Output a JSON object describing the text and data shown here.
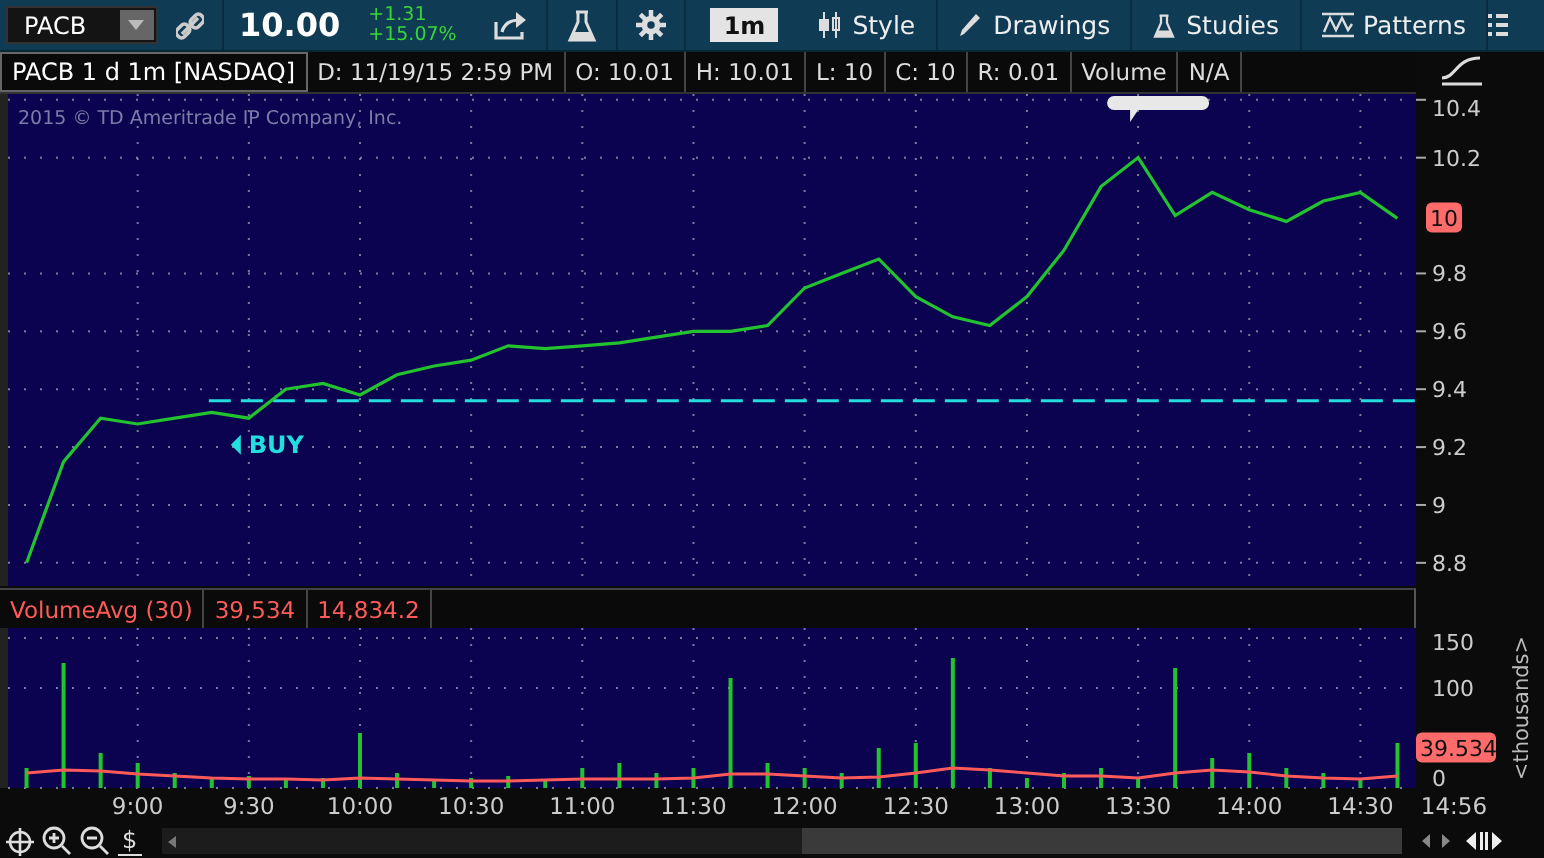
{
  "toolbar": {
    "symbol": "PACB",
    "last_price": "10.00",
    "change": "+1.31",
    "change_percent": "+15.07%",
    "interval": "1m",
    "menus": [
      "Style",
      "Drawings",
      "Studies",
      "Patterns"
    ]
  },
  "info_bar": {
    "title": "PACB 1 d 1m [NASDAQ]",
    "fields": [
      "D: 11/19/15 2:59 PM",
      "O: 10.01",
      "H: 10.01",
      "L: 10",
      "C: 10",
      "R: 0.01",
      "Volume",
      "N/A"
    ]
  },
  "price_chart": {
    "copyright": "2015 © TD Ameritrade IP Company, Inc.",
    "current_price_badge": "10",
    "chart_data": {
      "type": "line",
      "grid": true,
      "series": [
        {
          "color": "#22c32e",
          "values": [
            8.8,
            9.15,
            9.3,
            9.28,
            9.3,
            9.32,
            9.3,
            9.4,
            9.42,
            9.38,
            9.45,
            9.48,
            9.5,
            9.55,
            9.54,
            9.55,
            9.56,
            9.58,
            9.6,
            9.6,
            9.62,
            9.75,
            9.8,
            9.85,
            9.72,
            9.65,
            9.62,
            9.72,
            9.88,
            10.1,
            10.2,
            10.0,
            10.08,
            10.02,
            9.98,
            10.05,
            10.08,
            9.99
          ]
        }
      ],
      "ylim": [
        8.72,
        10.42
      ],
      "yticks": [
        8.8,
        9,
        9.2,
        9.4,
        9.6,
        9.8,
        10.2,
        10.4
      ],
      "ref_lines": [
        {
          "axis": "y",
          "value": 9.36
        }
      ],
      "annotations": [
        "BUY"
      ]
    }
  },
  "volume_panel": {
    "values": [
      "39,534",
      "14,834.2"
    ],
    "current_volume_badge": "39.534",
    "axis_unit": "<thousands>",
    "chart_data": {
      "type": "bar",
      "grid": true,
      "stacked": false,
      "categories": [
        null,
        null,
        null,
        "9:00",
        null,
        null,
        "9:30",
        null,
        null,
        "10:00",
        null,
        null,
        "10:30",
        null,
        null,
        "11:00",
        null,
        null,
        "11:30",
        null,
        null,
        "12:00",
        null,
        null,
        "12:30",
        null,
        null,
        "13:00",
        null,
        null,
        "13:30",
        null,
        null,
        "14:00",
        null,
        null,
        "14:30",
        null
      ],
      "series": [
        {
          "color": "#22c32e",
          "values": [
            20,
            125,
            35,
            25,
            15,
            10,
            12,
            8,
            10,
            55,
            15,
            8,
            10,
            12,
            8,
            20,
            25,
            15,
            20,
            110,
            25,
            20,
            15,
            40,
            45,
            130,
            20,
            10,
            15,
            20,
            10,
            120,
            30,
            35,
            20,
            15,
            10,
            45
          ]
        },
        {
          "name": "VolumeAvg (30)",
          "type": "line",
          "color": "#ff5a5a",
          "values": [
            15,
            18,
            17,
            14,
            12,
            10,
            9,
            9,
            8,
            10,
            9,
            8,
            7,
            7,
            8,
            9,
            9,
            9,
            10,
            14,
            14,
            12,
            10,
            11,
            15,
            20,
            18,
            15,
            12,
            12,
            10,
            15,
            18,
            16,
            12,
            10,
            9,
            12
          ]
        }
      ],
      "ylim": [
        0,
        160
      ],
      "yticks": [
        {
          "value": 0,
          "label": "0"
        },
        {
          "value": 100,
          "label": "100"
        },
        {
          "value": 150,
          "label": "150"
        }
      ]
    }
  },
  "time_axis": {
    "end_label": "14:56"
  },
  "bottom_bar": {
    "price_scale_button": "$"
  }
}
